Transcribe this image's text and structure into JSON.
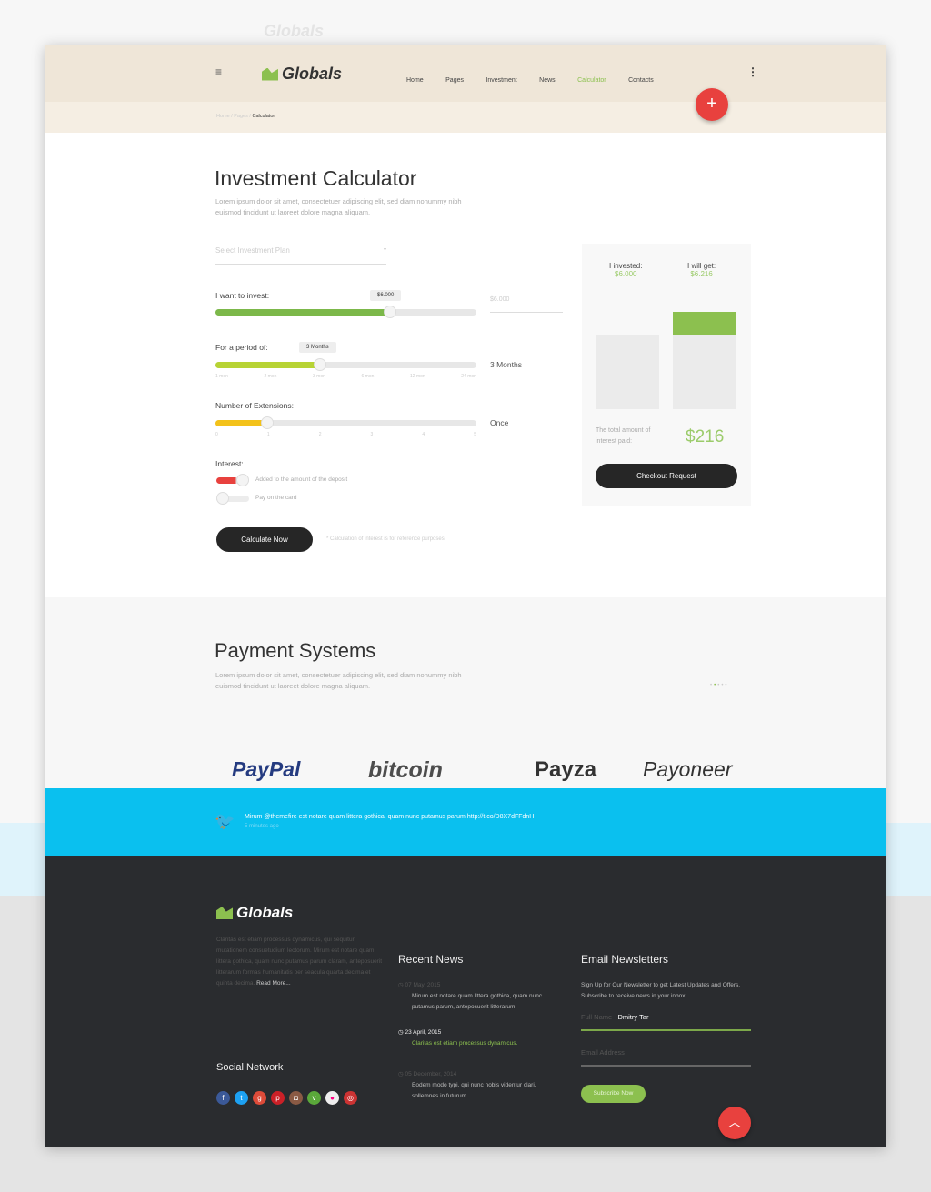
{
  "brand": "Globals",
  "nav": {
    "items": [
      "Home",
      "Pages",
      "Investment",
      "News",
      "Calculator",
      "Contacts"
    ],
    "active": "Calculator"
  },
  "breadcrumb": [
    "Home",
    "Pages",
    "Calculator"
  ],
  "calculator": {
    "title": "Investment Calculator",
    "intro": "Lorem ipsum dolor sit amet, consectetuer adipiscing elit, sed diam nonummy nibh euismod tincidunt ut laoreet dolore magna aliquam.",
    "plan_placeholder": "Select Investment Plan",
    "invest_label": "I want to invest:",
    "invest_value": "$6.000",
    "invest_input": "$6.000",
    "invest_fraction": 0.67,
    "period_label": "For a period of:",
    "period_value": "3 Months",
    "period_display": "3 Months",
    "period_ticks": [
      "1 mon",
      "2 mon",
      "3 mon",
      "6 mon",
      "12 mon",
      "24 mon"
    ],
    "period_fraction": 0.4,
    "ext_label": "Number of Extensions:",
    "ext_display": "Once",
    "ext_ticks": [
      "0",
      "1",
      "2",
      "3",
      "4",
      "5"
    ],
    "ext_fraction": 0.2,
    "interest_label": "Interest:",
    "interest_opt1": "Added to the amount of the deposit",
    "interest_opt2": "Pay on the card",
    "calc_button": "Calculate Now",
    "calc_note": "* Calculation of interest is for reference purposes"
  },
  "summary": {
    "invested_label": "I invested:",
    "invested": "$6.000",
    "get_label": "I will get:",
    "get": "$6.216",
    "total_label": "The total amount of interest paid:",
    "total": "$216",
    "checkout": "Checkout Request"
  },
  "payments": {
    "title": "Payment Systems",
    "intro": "Lorem ipsum dolor sit amet, consectetuer adipiscing elit, sed diam nonummy nibh euismod tincidunt ut laoreet dolore magna aliquam.",
    "logos": [
      "PayPal",
      "bitcoin",
      "Payza",
      "Payoneer"
    ]
  },
  "tweet": {
    "text": "Mirum @themefire est notare quam littera gothica, quam nunc putamus parum http://t.co/D8X7dFFdnH",
    "time": "5 minutes ago"
  },
  "footer": {
    "about": "Claritas est etiam processus dynamicus, qui sequitur mutationem consuetudium lectorum. Mirum est notare quam littera gothica, quam nunc putamus parum claram, anteposuerit litterarum formas humanitatis per seacula quarta decima et quinta decima.",
    "read_more": "Read More...",
    "social_title": "Social Network",
    "news_title": "Recent News",
    "news": [
      {
        "date": "07 May, 2015",
        "text": "Mirum est notare quam littera gothica, quam nunc putamus parum, anteposuerit litterarum."
      },
      {
        "date": "23 April, 2015",
        "text": "Claritas est etiam processus dynamicus."
      },
      {
        "date": "05 December, 2014",
        "text": "Eodem modo typi, qui nunc nobis videntur clari, sollemnes in futurum."
      }
    ],
    "newsletter_title": "Email Newsletters",
    "newsletter_text": "Sign Up for Our Newsletter to get Latest Updates and Offers. Subscribe to receive news in your inbox.",
    "name_label": "Full Name",
    "name_value": "Dmitry Tar",
    "email_placeholder": "Email Address",
    "subscribe": "Subscribe Now"
  },
  "colors": {
    "accent": "#8cc04f",
    "fab": "#e8413e",
    "twitter": "#0ac0ef",
    "footer": "#2a2c2f"
  }
}
